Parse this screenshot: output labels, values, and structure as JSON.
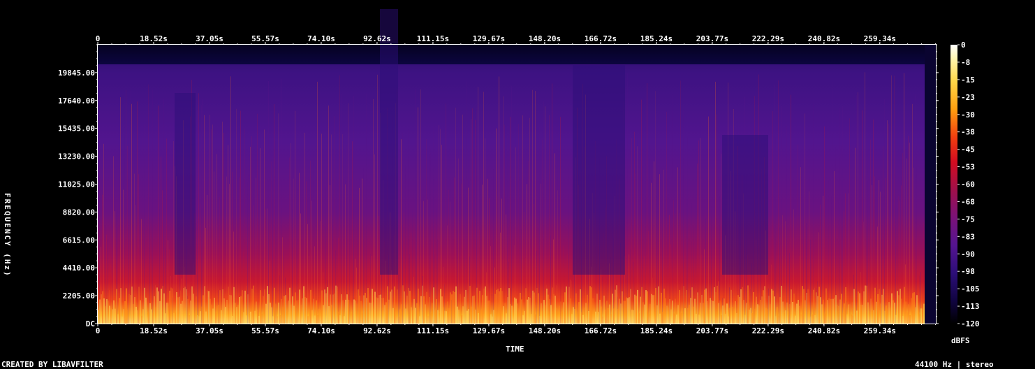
{
  "chart_data": {
    "type": "heatmap",
    "xlabel": "TIME",
    "ylabel": "FREQUENCY (Hz)",
    "x_ticks": [
      "0",
      "18.52s",
      "37.05s",
      "55.57s",
      "74.10s",
      "92.62s",
      "111.15s",
      "129.67s",
      "148.20s",
      "166.72s",
      "185.24s",
      "203.77s",
      "222.29s",
      "240.82s",
      "259.34s"
    ],
    "x_tick_values": [
      0,
      18.52,
      37.05,
      55.57,
      74.1,
      92.62,
      111.15,
      129.67,
      148.2,
      166.72,
      185.24,
      203.77,
      222.29,
      240.82,
      259.34
    ],
    "xlim": [
      0,
      277.9
    ],
    "y_ticks": [
      "DC",
      "2205.00",
      "4410.00",
      "6615.00",
      "8820.00",
      "11025.00",
      "13230.00",
      "15435.00",
      "17640.00",
      "19845.00"
    ],
    "y_tick_values": [
      0,
      2205,
      4410,
      6615,
      8820,
      11025,
      13230,
      15435,
      17640,
      19845
    ],
    "ylim": [
      0,
      22050
    ],
    "colorbar": {
      "label": "dBFS",
      "ticks": [
        "0",
        "-8",
        "-15",
        "-23",
        "-30",
        "-38",
        "-45",
        "-53",
        "-60",
        "-68",
        "-75",
        "-83",
        "-90",
        "-98",
        "-105",
        "-113",
        "-120"
      ],
      "range": [
        -120,
        0
      ]
    },
    "sample_rate_hz": 44100,
    "channels": "stereo"
  },
  "footer": {
    "left": "CREATED BY LIBAVFILTER",
    "right": "44100 Hz | stereo"
  }
}
